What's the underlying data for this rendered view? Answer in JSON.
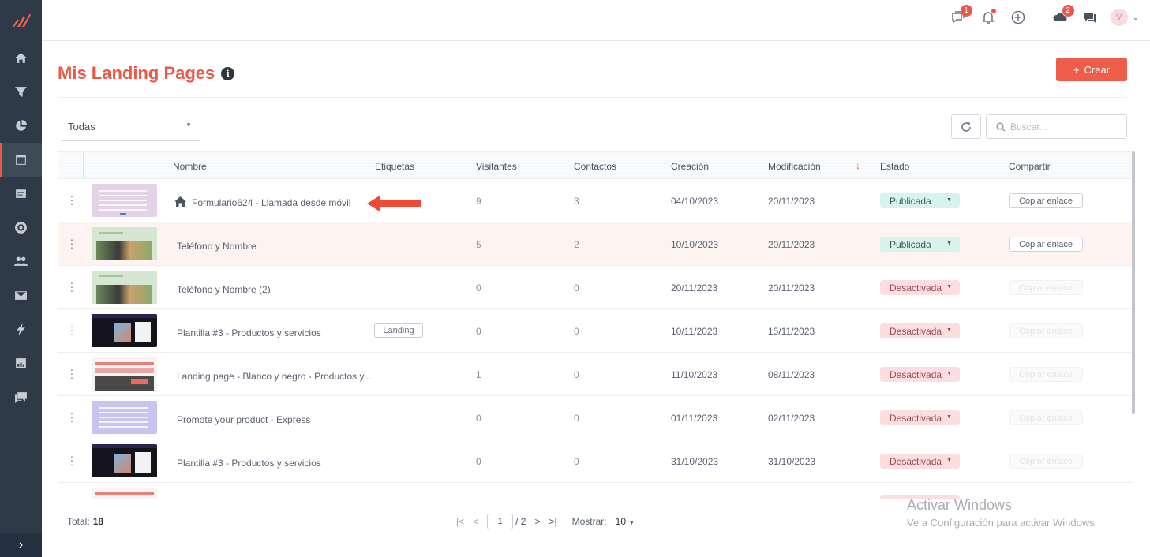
{
  "topbar": {
    "chat_badge": "1",
    "cloud_badge": "2",
    "avatar": "V"
  },
  "header": {
    "title": "Mis Landing Pages",
    "info": "i",
    "create_label": "Crear",
    "create_icon": "+"
  },
  "filters": {
    "select_value": "Todas",
    "search_placeholder": "Buscar..."
  },
  "table": {
    "columns": [
      "Nombre",
      "Etiquetas",
      "Visitantes",
      "Contactos",
      "Creación",
      "Modificación",
      "Estado",
      "Compartir"
    ],
    "rows": [
      {
        "name": "Formulario624 - Llamada desde móvil",
        "tag": "",
        "visitors": "9",
        "contacts": "3",
        "created": "04/10/2023",
        "modified": "20/11/2023",
        "status": "Publicada",
        "share": "Copiar enlace",
        "home": true
      },
      {
        "name": "Teléfono y Nombre",
        "tag": "",
        "visitors": "5",
        "contacts": "2",
        "created": "10/10/2023",
        "modified": "20/11/2023",
        "status": "Publicada",
        "share": "Copiar enlace"
      },
      {
        "name": "Teléfono y Nombre (2)",
        "tag": "",
        "visitors": "0",
        "contacts": "0",
        "created": "20/11/2023",
        "modified": "20/11/2023",
        "status": "Desactivada",
        "share": "Copiar enlace"
      },
      {
        "name": "Plantilla #3 - Productos y servicios",
        "tag": "Landing",
        "visitors": "0",
        "contacts": "0",
        "created": "10/11/2023",
        "modified": "15/11/2023",
        "status": "Desactivada",
        "share": "Copiar enlace"
      },
      {
        "name": "Landing page - Blanco y negro - Productos y...",
        "tag": "",
        "visitors": "1",
        "contacts": "0",
        "created": "11/10/2023",
        "modified": "08/11/2023",
        "status": "Desactivada",
        "share": "Copiar enlace"
      },
      {
        "name": "Promote your product - Express",
        "tag": "",
        "visitors": "0",
        "contacts": "0",
        "created": "01/11/2023",
        "modified": "02/11/2023",
        "status": "Desactivada",
        "share": "Copiar enlace"
      },
      {
        "name": "Plantilla #3 - Productos y servicios",
        "tag": "",
        "visitors": "0",
        "contacts": "0",
        "created": "31/10/2023",
        "modified": "31/10/2023",
        "status": "Desactivada",
        "share": "Copiar enlace"
      }
    ]
  },
  "footer": {
    "total_label": "Total:",
    "total_value": "18",
    "current_page": "1",
    "total_pages": "/ 2",
    "show_label": "Mostrar:",
    "show_value": "10"
  },
  "watermark": {
    "line1": "Activar Windows",
    "line2": "Ve a Configuración para activar Windows."
  },
  "colors": {
    "accent": "#ee5d4a",
    "sidebar": "#2e3a47",
    "published_bg": "#d7f3ec",
    "disabled_bg": "#fbdfe0"
  }
}
